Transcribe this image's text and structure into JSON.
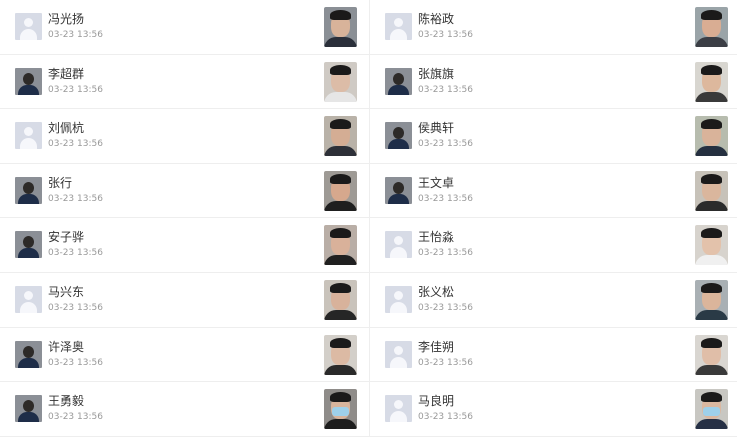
{
  "entries": [
    {
      "name": "冯光扬",
      "time": "03-23 13:56",
      "avatar": "default-avatar-icon",
      "selfie": {
        "bg": "#8a8f95",
        "skin": "#d8b39a",
        "shirt": "#2a2f3a",
        "mask": false
      }
    },
    {
      "name": "陈裕政",
      "time": "03-23 13:56",
      "avatar": "default-avatar-icon",
      "selfie": {
        "bg": "#9aa4a8",
        "skin": "#d9ad93",
        "shirt": "#3b3e45",
        "mask": false
      }
    },
    {
      "name": "李超群",
      "time": "03-23 13:56",
      "avatar": "photo-avatar-icon",
      "selfie": {
        "bg": "#cfcac4",
        "skin": "#dcbca7",
        "shirt": "#e6e6e6",
        "mask": false
      }
    },
    {
      "name": "张旗旗",
      "time": "03-23 13:56",
      "avatar": "photo-avatar-icon",
      "selfie": {
        "bg": "#d8d6d0",
        "skin": "#ddb89d",
        "shirt": "#3a3a3a",
        "mask": false
      }
    },
    {
      "name": "刘佩杭",
      "time": "03-23 13:56",
      "avatar": "default-avatar-icon",
      "selfie": {
        "bg": "#b9b2a8",
        "skin": "#d4ad94",
        "shirt": "#2d3038",
        "mask": false
      }
    },
    {
      "name": "侯典轩",
      "time": "03-23 13:56",
      "avatar": "panda-meme-avatar-icon",
      "selfie": {
        "bg": "#b7bcae",
        "skin": "#d9b39a",
        "shirt": "#253040",
        "mask": false
      }
    },
    {
      "name": "张行",
      "time": "03-23 13:56",
      "avatar": "photo-avatar-icon",
      "selfie": {
        "bg": "#9e9a95",
        "skin": "#d6a88d",
        "shirt": "#1f1f1f",
        "mask": false
      }
    },
    {
      "name": "王文卓",
      "time": "03-23 13:56",
      "avatar": "photo-avatar-icon",
      "selfie": {
        "bg": "#c7c2b9",
        "skin": "#dab69d",
        "shirt": "#2b2b2b",
        "mask": false
      }
    },
    {
      "name": "安子骅",
      "time": "03-23 13:56",
      "avatar": "photo-avatar-icon",
      "selfie": {
        "bg": "#b9aea6",
        "skin": "#d9b19a",
        "shirt": "#202020",
        "mask": false
      }
    },
    {
      "name": "王怡淼",
      "time": "03-23 13:56",
      "avatar": "default-avatar-icon",
      "selfie": {
        "bg": "#d7d3cd",
        "skin": "#e3c2ab",
        "shirt": "#f0f0f0",
        "mask": false
      }
    },
    {
      "name": "马兴东",
      "time": "03-23 13:56",
      "avatar": "default-avatar-icon",
      "selfie": {
        "bg": "#c9c3bb",
        "skin": "#d8b29b",
        "shirt": "#262626",
        "mask": false
      }
    },
    {
      "name": "张义松",
      "time": "03-23 13:56",
      "avatar": "default-avatar-icon",
      "selfie": {
        "bg": "#a9b0b4",
        "skin": "#dbb59b",
        "shirt": "#2a3a46",
        "mask": false
      }
    },
    {
      "name": "许泽奥",
      "time": "03-23 13:56",
      "avatar": "anime-avatar-icon",
      "selfie": {
        "bg": "#d3cfc9",
        "skin": "#dcbaa4",
        "shirt": "#2a2a2a",
        "mask": false
      }
    },
    {
      "name": "李佳朔",
      "time": "03-23 13:56",
      "avatar": "default-avatar-icon",
      "selfie": {
        "bg": "#d9d6d1",
        "skin": "#e0bea8",
        "shirt": "#3a3a3a",
        "mask": false
      }
    },
    {
      "name": "王勇毅",
      "time": "03-23 13:56",
      "avatar": "anime-avatar-icon",
      "selfie": {
        "bg": "#8f8c89",
        "skin": "#d8b49c",
        "shirt": "#1d1d1d",
        "mask": true
      }
    },
    {
      "name": "马良明",
      "time": "03-23 13:56",
      "avatar": "default-avatar-icon",
      "selfie": {
        "bg": "#c8c7c2",
        "skin": "#dbb8a0",
        "shirt": "#263045",
        "mask": true
      }
    }
  ]
}
